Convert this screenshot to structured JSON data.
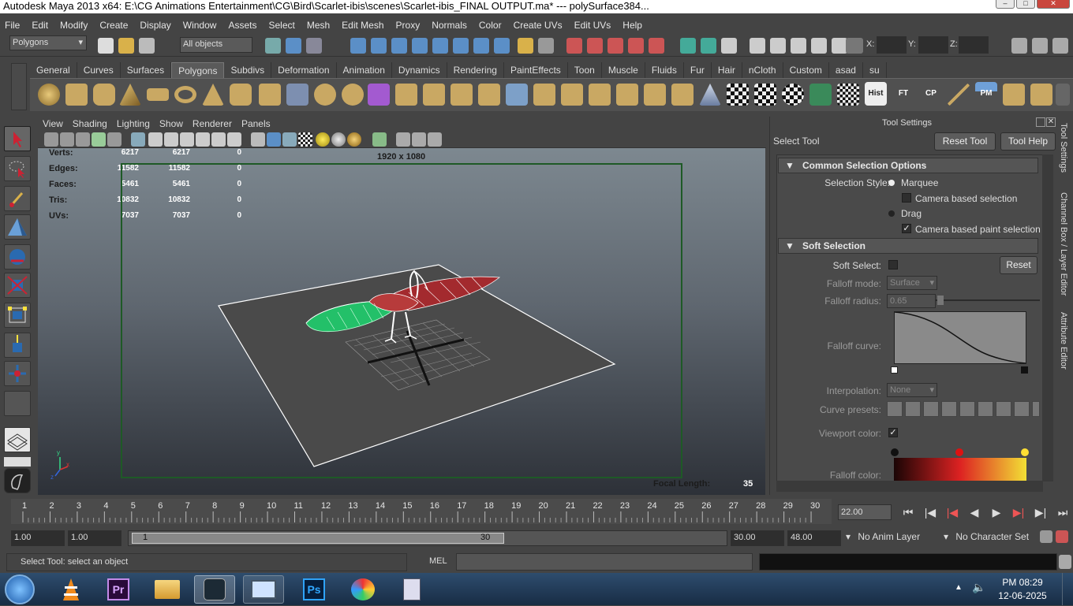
{
  "window": {
    "title": "Autodesk Maya 2013 x64: E:\\CG Animations Entertainment\\CG\\Bird\\Scarlet-ibis\\scenes\\Scarlet-ibis_FINAL OUTPUT.ma*   ---   polySurface384..."
  },
  "menus": [
    "File",
    "Edit",
    "Modify",
    "Create",
    "Display",
    "Window",
    "Assets",
    "Select",
    "Mesh",
    "Edit Mesh",
    "Proxy",
    "Normals",
    "Color",
    "Create UVs",
    "Edit UVs",
    "Help"
  ],
  "status_line": {
    "mode": "Polygons",
    "selection_field": "All objects",
    "x_label": "X:",
    "y_label": "Y:",
    "z_label": "Z:"
  },
  "shelf_tabs": [
    "General",
    "Curves",
    "Surfaces",
    "Polygons",
    "Subdivs",
    "Deformation",
    "Animation",
    "Dynamics",
    "Rendering",
    "PaintEffects",
    "Toon",
    "Muscle",
    "Fluids",
    "Fur",
    "Hair",
    "nCloth",
    "Custom",
    "asad",
    "su"
  ],
  "shelf_active": "Polygons",
  "shelf_text_buttons": [
    "Hist",
    "FT",
    "CP",
    "PM"
  ],
  "panel_menu": [
    "View",
    "Shading",
    "Lighting",
    "Show",
    "Renderer",
    "Panels"
  ],
  "hud": {
    "rows": [
      {
        "label": "Verts:",
        "a": "6217",
        "b": "6217",
        "c": "0"
      },
      {
        "label": "Edges:",
        "a": "11582",
        "b": "11582",
        "c": "0"
      },
      {
        "label": "Faces:",
        "a": "5461",
        "b": "5461",
        "c": "0"
      },
      {
        "label": "Tris:",
        "a": "10832",
        "b": "10832",
        "c": "0"
      },
      {
        "label": "UVs:",
        "a": "7037",
        "b": "7037",
        "c": "0"
      }
    ],
    "resolution": "1920 x 1080",
    "focal_label": "Focal Length:",
    "focal_value": "35"
  },
  "tool_settings": {
    "header": "Tool Settings",
    "tool_name": "Select Tool",
    "reset_tool": "Reset Tool",
    "tool_help": "Tool Help",
    "common_section": "Common Selection Options",
    "selection_style_label": "Selection Style:",
    "marquee": "Marquee",
    "camera_based": "Camera based selection",
    "drag": "Drag",
    "camera_based_paint": "Camera based paint selection",
    "soft_section": "Soft Selection",
    "soft_select_label": "Soft Select:",
    "reset": "Reset",
    "falloff_mode_label": "Falloff mode:",
    "falloff_mode_value": "Surface",
    "falloff_radius_label": "Falloff radius:",
    "falloff_radius_value": "0.65",
    "falloff_curve_label": "Falloff curve:",
    "interpolation_label": "Interpolation:",
    "interpolation_value": "None",
    "curve_presets_label": "Curve presets:",
    "viewport_color_label": "Viewport color:",
    "falloff_color_label": "Falloff color:"
  },
  "side_tabs": [
    "Tool Settings",
    "Channel Box / Layer Editor",
    "Attribute Editor"
  ],
  "timeline": {
    "ticks": [
      "1",
      "2",
      "3",
      "4",
      "5",
      "6",
      "7",
      "8",
      "9",
      "10",
      "11",
      "12",
      "13",
      "14",
      "15",
      "16",
      "17",
      "18",
      "19",
      "20",
      "21",
      "22",
      "23",
      "24",
      "25",
      "26",
      "27",
      "28",
      "29",
      "30"
    ],
    "current_frame": "22.00"
  },
  "range": {
    "start": "1.00",
    "start2": "1.00",
    "slider_start": "1",
    "slider_end": "30",
    "end": "30.00",
    "end2": "48.00",
    "anim_layer": "No Anim Layer",
    "char_set": "No Character Set"
  },
  "command": {
    "help_text": "Select Tool: select an object",
    "lang": "MEL"
  },
  "taskbar": {
    "time": "PM 08:29",
    "date": "12-06-2025"
  },
  "colors": {
    "accent_green": "#1e5a26",
    "wire_white": "#ffffff",
    "wire_green": "#3ddc84",
    "wire_red": "#b0282a"
  }
}
